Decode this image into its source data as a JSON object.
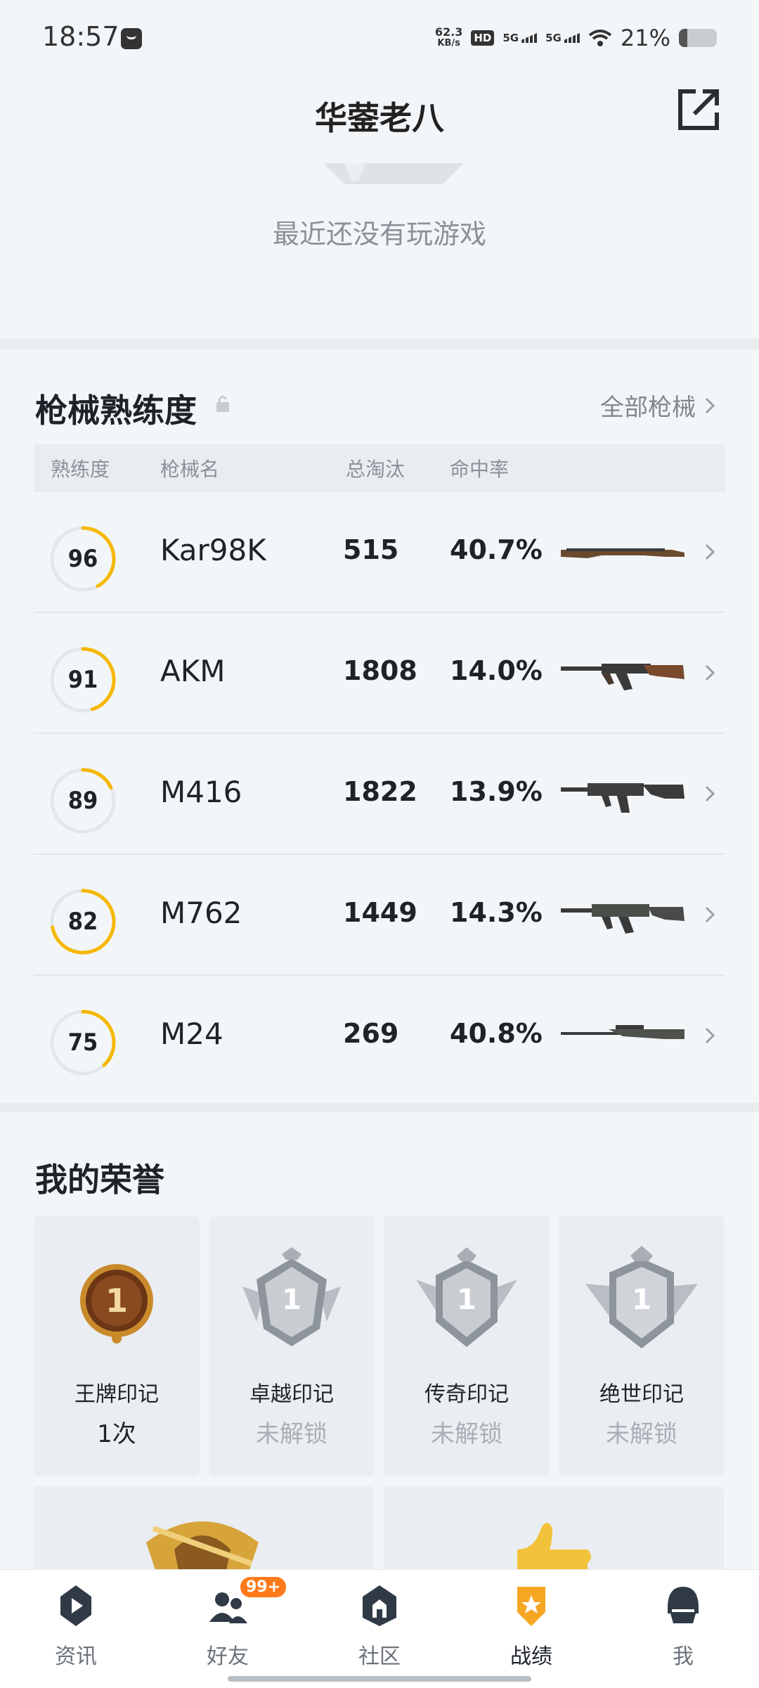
{
  "status_bar": {
    "time": "18:57",
    "speed": "62.3",
    "speed_unit": "KB/s",
    "hd": "HD",
    "net1": "5G",
    "net2": "5G",
    "battery": "21%"
  },
  "header": {
    "title": "华蓥老八"
  },
  "recent": {
    "empty_text": "最近还没有玩游戏"
  },
  "weapons": {
    "title": "枪械熟练度",
    "all_label": "全部枪械",
    "columns": {
      "proficiency": "熟练度",
      "name": "枪械名",
      "kills": "总淘汰",
      "accuracy": "命中率"
    },
    "rows": [
      {
        "level": "96",
        "progress": 0.42,
        "name": "Kar98K",
        "kills": "515",
        "accuracy": "40.7%",
        "gun": "rifle-bolt"
      },
      {
        "level": "91",
        "progress": 0.45,
        "name": "AKM",
        "kills": "1808",
        "accuracy": "14.0%",
        "gun": "rifle-ak"
      },
      {
        "level": "89",
        "progress": 0.18,
        "name": "M416",
        "kills": "1822",
        "accuracy": "13.9%",
        "gun": "rifle-m4"
      },
      {
        "level": "82",
        "progress": 0.72,
        "name": "M762",
        "kills": "1449",
        "accuracy": "14.3%",
        "gun": "rifle-ak-tactical"
      },
      {
        "level": "75",
        "progress": 0.38,
        "name": "M24",
        "kills": "269",
        "accuracy": "40.8%",
        "gun": "sniper"
      }
    ],
    "ring_color": "#f5b800"
  },
  "honors": {
    "title": "我的荣誉",
    "cards": [
      {
        "name": "王牌印记",
        "value": "1次",
        "locked": false,
        "icon": "ace-medal-icon"
      },
      {
        "name": "卓越印记",
        "value": "未解锁",
        "locked": true,
        "icon": "excellent-medal-icon"
      },
      {
        "name": "传奇印记",
        "value": "未解锁",
        "locked": true,
        "icon": "legend-medal-icon"
      },
      {
        "name": "绝世印记",
        "value": "未解锁",
        "locked": true,
        "icon": "peerless-medal-icon"
      }
    ]
  },
  "nav": {
    "items": [
      {
        "label": "资讯",
        "icon": "news-icon"
      },
      {
        "label": "好友",
        "icon": "friends-icon",
        "badge": "99+"
      },
      {
        "label": "社区",
        "icon": "community-icon"
      },
      {
        "label": "战绩",
        "icon": "stats-icon",
        "active": true
      },
      {
        "label": "我",
        "icon": "profile-icon"
      }
    ]
  }
}
